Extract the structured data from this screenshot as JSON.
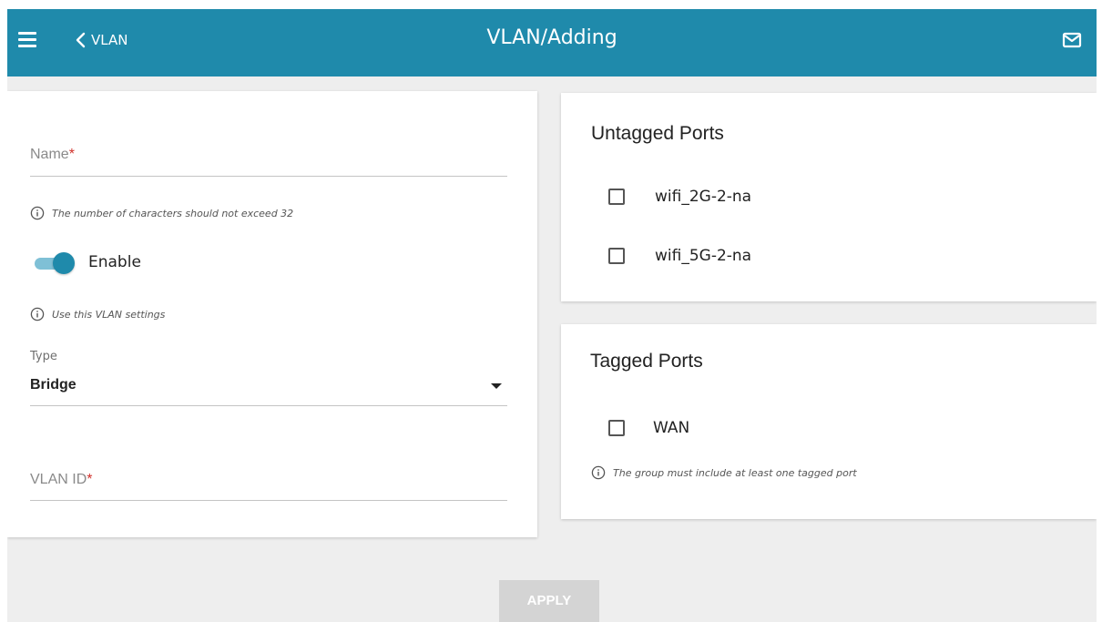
{
  "header": {
    "back_label": "VLAN",
    "title": "VLAN/Adding"
  },
  "form": {
    "name": {
      "label": "Name",
      "required_mark": "*",
      "value": ""
    },
    "name_hint": "The number of characters should not exceed 32",
    "enable": {
      "label": "Enable",
      "checked": true
    },
    "enable_hint": "Use this VLAN settings",
    "type": {
      "label": "Type",
      "value": "Bridge"
    },
    "vlan_id": {
      "label": "VLAN ID",
      "required_mark": "*",
      "value": ""
    }
  },
  "untagged": {
    "title": "Untagged Ports",
    "ports": [
      {
        "label": "wifi_2G-2-na",
        "checked": false
      },
      {
        "label": "wifi_5G-2-na",
        "checked": false
      }
    ]
  },
  "tagged": {
    "title": "Tagged Ports",
    "ports": [
      {
        "label": "WAN",
        "checked": false
      }
    ],
    "hint": "The group must include at least one tagged port"
  },
  "apply_label": "APPLY",
  "colors": {
    "accent": "#1f8aab",
    "toggle_track": "#7fc0d6",
    "required": "#d0302a",
    "page_bg": "#eeeeee",
    "apply_disabled": "#d4d4d4"
  }
}
